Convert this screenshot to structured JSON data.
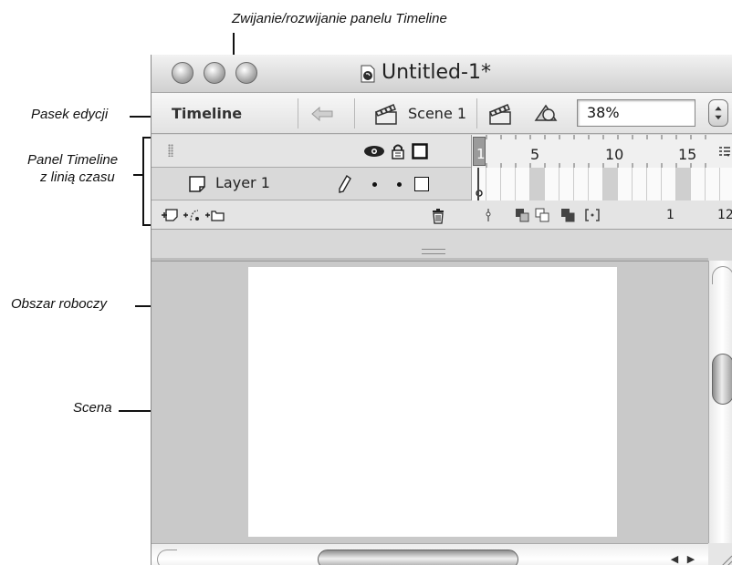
{
  "annotations": {
    "top": "Zwijanie/rozwijanie panelu Timeline",
    "edit_bar": "Pasek edycji",
    "timeline_panel_line1": "Panel Timeline",
    "timeline_panel_line2": "z linią czasu",
    "work_area": "Obszar roboczy",
    "stage": "Scena"
  },
  "window": {
    "title": "Untitled-1*"
  },
  "edit_bar": {
    "timeline_label": "Timeline",
    "scene_label": "Scene 1",
    "zoom_value": "38%"
  },
  "timeline": {
    "playhead_frame": "1",
    "ruler_numbers": [
      "5",
      "10",
      "15"
    ],
    "layer_name": "Layer 1",
    "footer_current_frame": "1",
    "footer_fps": "12"
  },
  "colors": {
    "work_area": "#c9c9c9",
    "stage": "#ffffff",
    "chrome": "#e4e4e4"
  }
}
